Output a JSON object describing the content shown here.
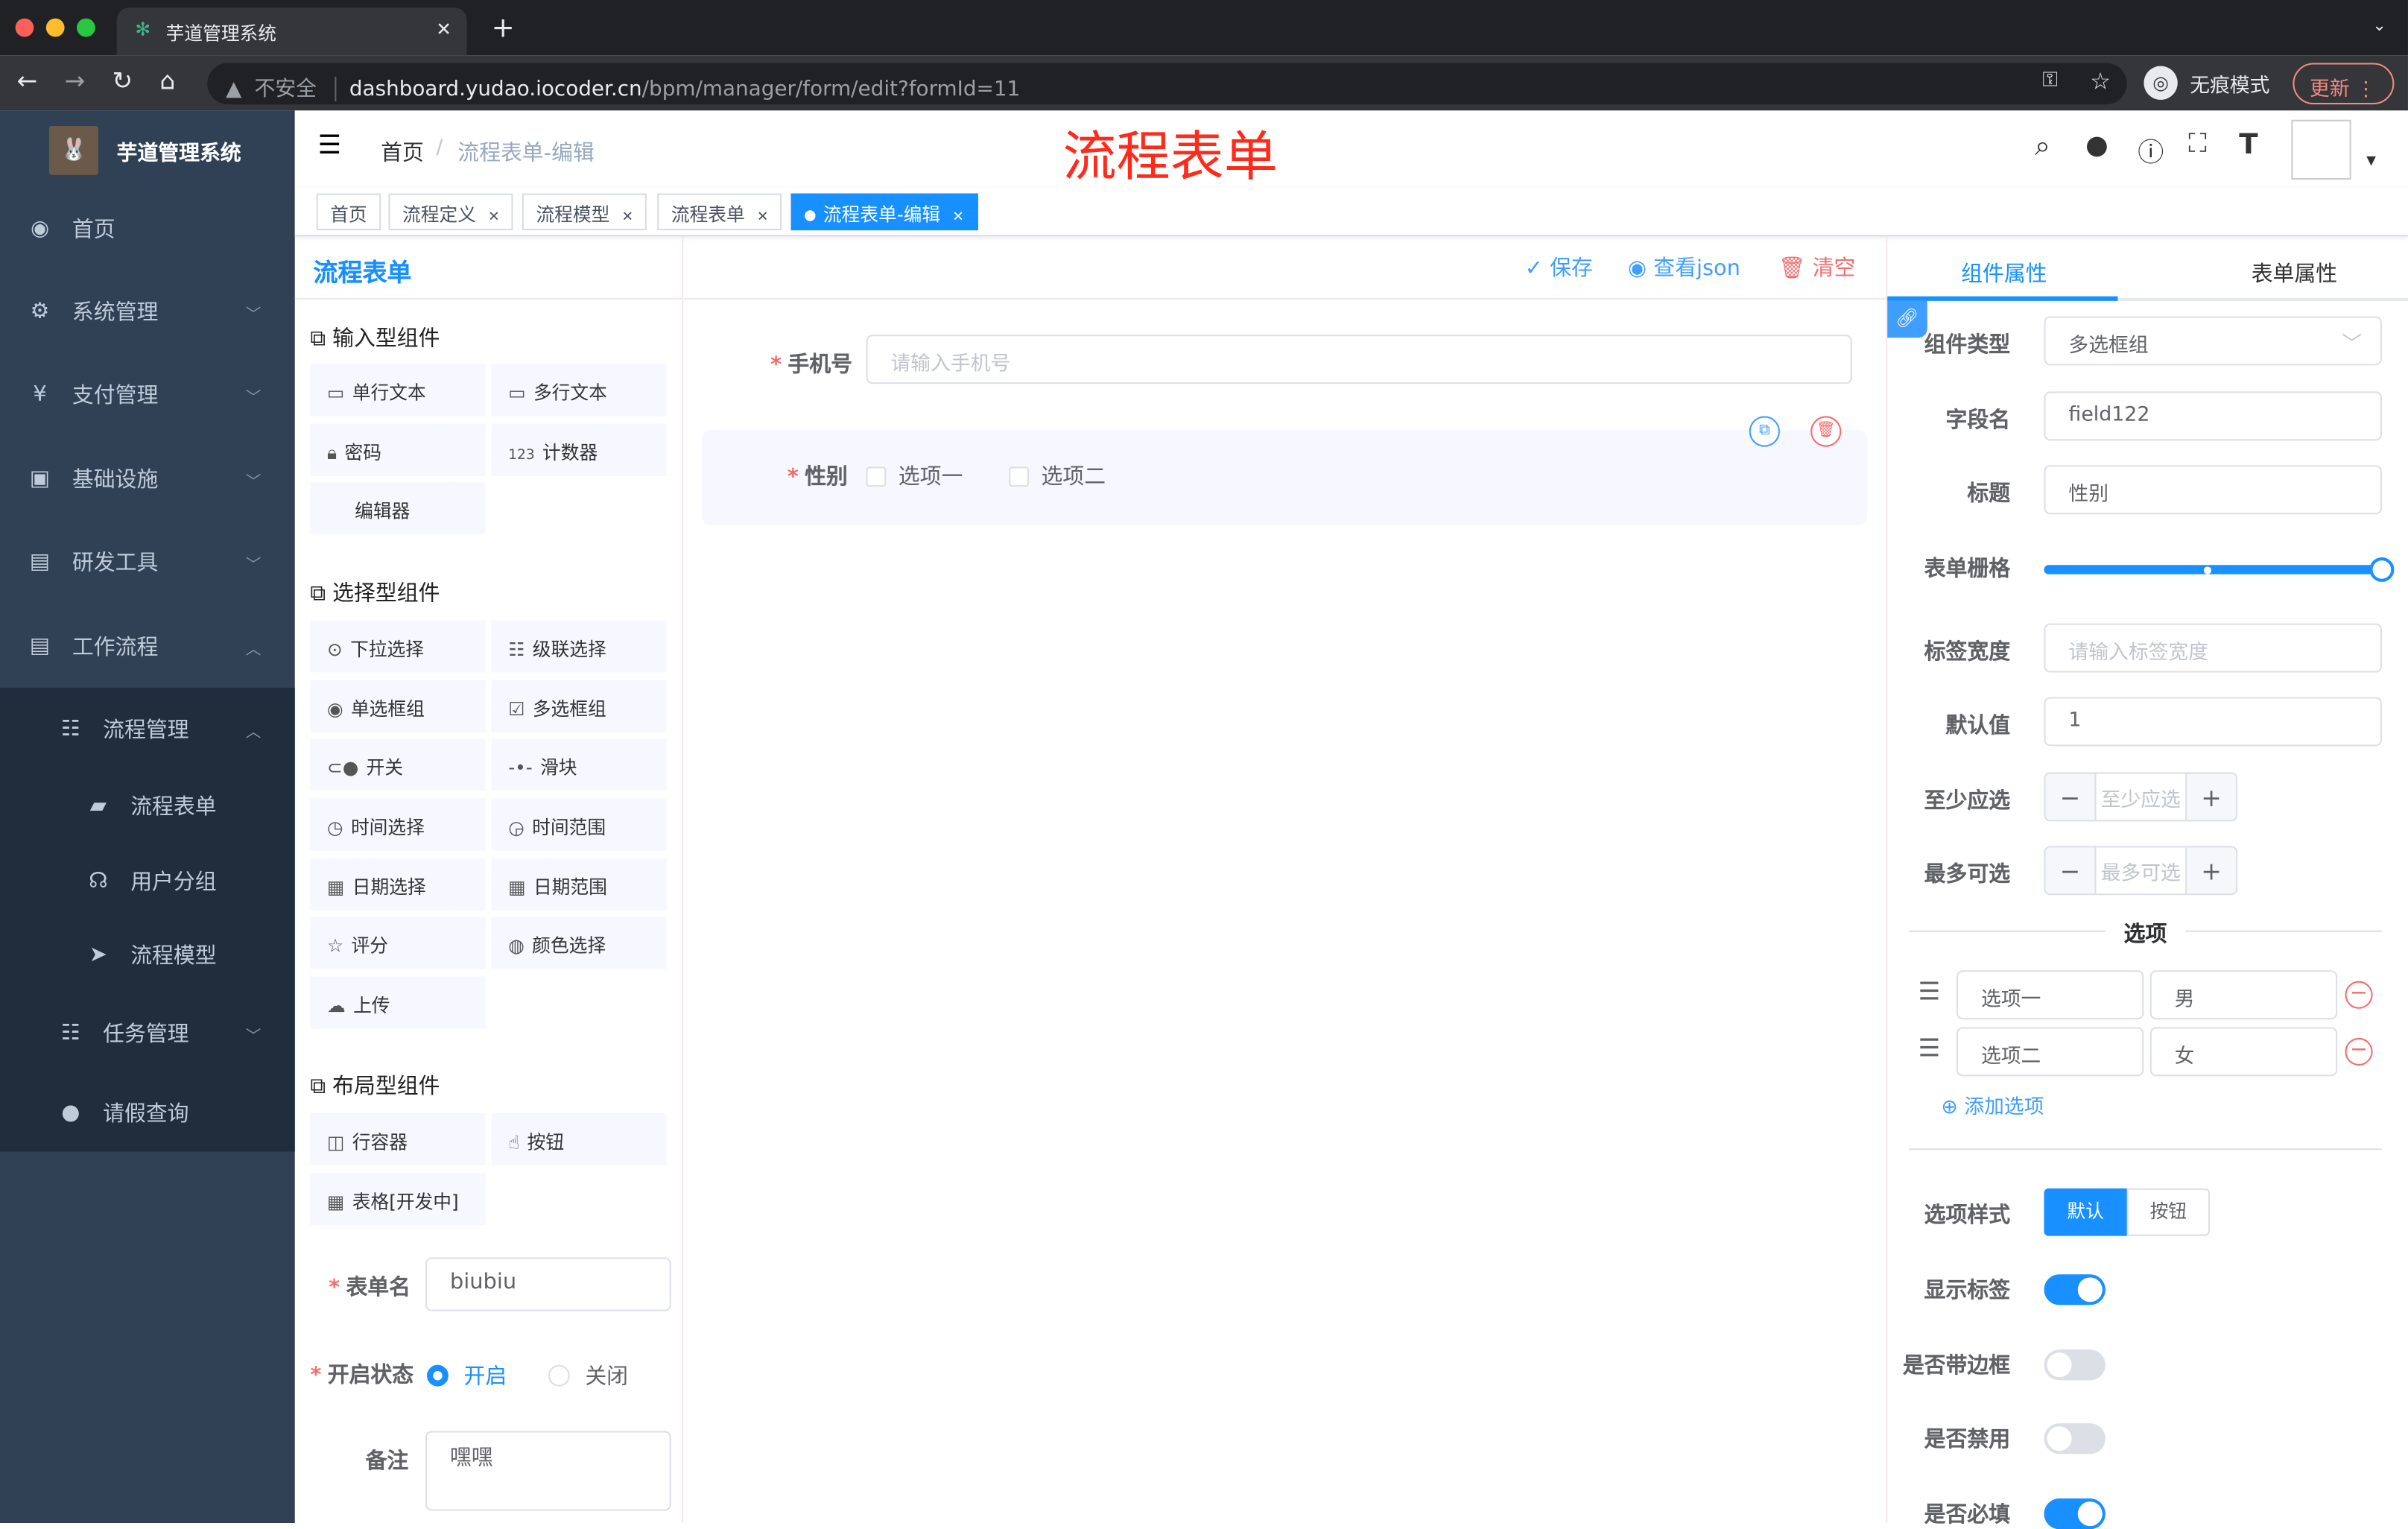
{
  "browser": {
    "tab_title": "芋道管理系统",
    "insecure_label": "不安全",
    "url_host": "dashboard.yudao.iocoder.cn",
    "url_path": "/bpm/manager/form/edit?formId=11",
    "incognito_label": "无痕模式",
    "update_label": "更新"
  },
  "sidebar": {
    "app_title": "芋道管理系统",
    "items": [
      {
        "label": "首页",
        "icon": "dashboard-icon"
      },
      {
        "label": "系统管理",
        "icon": "gear-icon"
      },
      {
        "label": "支付管理",
        "icon": "yen-icon"
      },
      {
        "label": "基础设施",
        "icon": "monitor-icon"
      },
      {
        "label": "研发工具",
        "icon": "toolbox-icon"
      },
      {
        "label": "工作流程",
        "icon": "toolbox-icon"
      },
      {
        "label": "流程管理",
        "icon": "tree-icon"
      },
      {
        "label": "流程表单",
        "icon": "form-icon"
      },
      {
        "label": "用户分组",
        "icon": "peoples-icon"
      },
      {
        "label": "流程模型",
        "icon": "send-icon"
      },
      {
        "label": "任务管理",
        "icon": "tree-icon"
      },
      {
        "label": "请假查询",
        "icon": "user-icon"
      }
    ]
  },
  "navbar": {
    "breadcrumb_home": "首页",
    "breadcrumb_current": "流程表单-编辑",
    "page_heading": "流程表单"
  },
  "tags": [
    {
      "label": "首页"
    },
    {
      "label": "流程定义"
    },
    {
      "label": "流程模型"
    },
    {
      "label": "流程表单"
    },
    {
      "label": "流程表单-编辑",
      "active": true
    }
  ],
  "left_panel": {
    "title": "流程表单",
    "input_category": "输入型组件",
    "input_items": [
      "单行文本",
      "多行文本",
      "密码",
      "计数器",
      "编辑器"
    ],
    "select_category": "选择型组件",
    "select_items": [
      "下拉选择",
      "级联选择",
      "单选框组",
      "多选框组",
      "开关",
      "滑块",
      "时间选择",
      "时间范围",
      "日期选择",
      "日期范围",
      "评分",
      "颜色选择",
      "上传"
    ],
    "layout_category": "布局型组件",
    "layout_items": [
      "行容器",
      "按钮",
      "表格[开发中]"
    ],
    "form_name_label": "表单名",
    "form_name_value": "biubiu",
    "status_label": "开启状态",
    "status_on": "开启",
    "status_off": "关闭",
    "status_selected": "开启",
    "remark_label": "备注",
    "remark_value": "嘿嘿"
  },
  "toolbar": {
    "save": "保存",
    "view_json": "查看json",
    "clear": "清空"
  },
  "canvas": {
    "phone_label": "手机号",
    "phone_placeholder": "请输入手机号",
    "gender_label": "性别",
    "gender_options": [
      "选项一",
      "选项二"
    ]
  },
  "right_panel": {
    "tab_component": "组件属性",
    "tab_form": "表单属性",
    "active_tab": "组件属性",
    "component_type_label": "组件类型",
    "component_type_value": "多选框组",
    "field_name_label": "字段名",
    "field_name_value": "field122",
    "title_label": "标题",
    "title_value": "性别",
    "grid_label": "表单栅格",
    "grid_value": 24,
    "grid_max": 24,
    "label_width_label": "标签宽度",
    "label_width_placeholder": "请输入标签宽度",
    "default_label": "默认值",
    "default_value": "1",
    "min_label": "至少应选",
    "min_placeholder": "至少应选",
    "max_label": "最多可选",
    "max_placeholder": "最多可选",
    "options_divider": "选项",
    "options": [
      {
        "label": "选项一",
        "value": "男"
      },
      {
        "label": "选项二",
        "value": "女"
      }
    ],
    "add_option": "添加选项",
    "option_style_label": "选项样式",
    "option_style_default": "默认",
    "option_style_button": "按钮",
    "show_label_label": "显示标签",
    "show_label": true,
    "border_label": "是否带边框",
    "border": false,
    "disabled_label": "是否禁用",
    "disabled": false,
    "required_label": "是否必填",
    "required": true
  },
  "colors": {
    "accent": "#1890ff",
    "sidebar": "#304156",
    "danger": "#f56c6c",
    "heading_red": "#ff2a1a"
  }
}
